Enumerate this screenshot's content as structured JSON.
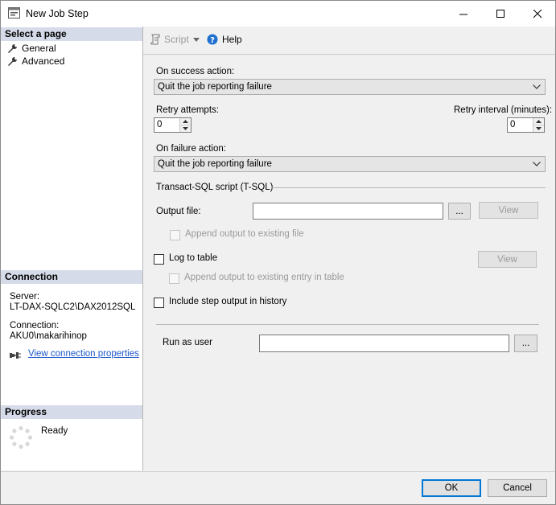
{
  "window": {
    "title": "New Job Step"
  },
  "left_pane": {
    "select_page_header": "Select a page",
    "pages": [
      {
        "label": "General"
      },
      {
        "label": "Advanced"
      }
    ],
    "connection_header": "Connection",
    "server_label": "Server:",
    "server_value": "LT-DAX-SQLC2\\DAX2012SQL",
    "connection_label": "Connection:",
    "connection_value": "AKU0\\makarihinop",
    "view_connection_link": "View connection properties",
    "progress_header": "Progress",
    "progress_status": "Ready"
  },
  "toolbar": {
    "script_label": "Script",
    "help_label": "Help"
  },
  "form": {
    "on_success_label": "On success action:",
    "on_success_value": "Quit the job reporting failure",
    "retry_attempts_label": "Retry attempts:",
    "retry_attempts_value": "0",
    "retry_interval_label": "Retry interval (minutes):",
    "retry_interval_value": "0",
    "on_failure_label": "On failure action:",
    "on_failure_value": "Quit the job reporting failure",
    "tsql_section_label": "Transact-SQL script (T-SQL)",
    "output_file_label": "Output file:",
    "output_file_value": "",
    "browse_label": "...",
    "view_label": "View",
    "append_output_label": "Append output to existing file",
    "log_to_table_label": "Log to table",
    "view2_label": "View",
    "append_entry_label": "Append output to existing entry in table",
    "include_history_label": "Include step output in history",
    "run_as_user_label": "Run as user",
    "run_as_user_value": "",
    "run_as_browse_label": "..."
  },
  "footer": {
    "ok_label": "OK",
    "cancel_label": "Cancel"
  },
  "colors": {
    "header_bg": "#d6dbe9",
    "link": "#1a56c8",
    "help_icon": "#1e6fd0",
    "accent": "#0078d7"
  }
}
